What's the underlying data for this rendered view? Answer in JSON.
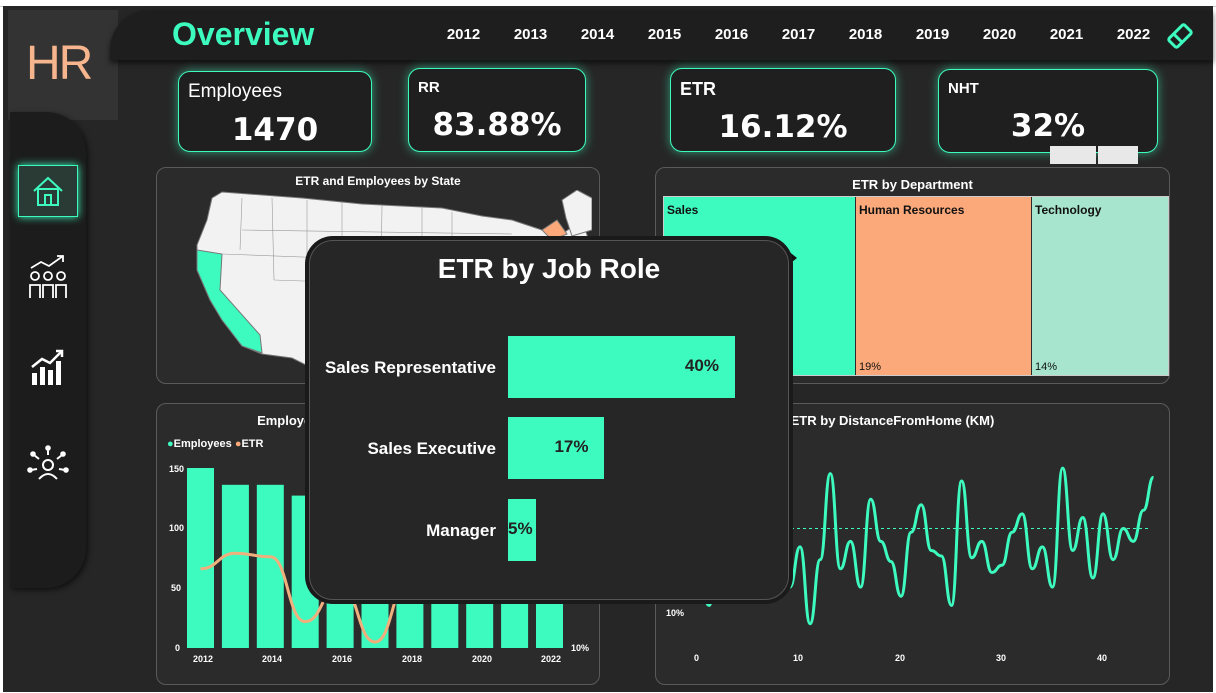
{
  "header": {
    "title": "Overview",
    "years": [
      "2012",
      "2013",
      "2014",
      "2015",
      "2016",
      "2017",
      "2018",
      "2019",
      "2020",
      "2021",
      "2022"
    ]
  },
  "logo": "HR",
  "nav": [
    "home-icon",
    "people-growth-icon",
    "chart-bars-icon",
    "network-person-icon"
  ],
  "kpis": {
    "employees": {
      "label": "Employees",
      "value": "1470"
    },
    "rr": {
      "label": "RR",
      "value": "83.88%"
    },
    "etr": {
      "label": "ETR",
      "value": "16.12%"
    },
    "nht": {
      "label": "NHT",
      "value": "32%"
    }
  },
  "map_panel": {
    "title": "ETR and Employees by State"
  },
  "dept_panel": {
    "title": "ETR by Department",
    "departments": [
      {
        "name": "Sales",
        "value": "",
        "share": 0.46,
        "color": "#3dfbbe"
      },
      {
        "name": "Human Resources",
        "value": "19%",
        "share": 0.3,
        "color": "#fba97a"
      },
      {
        "name": "Technology",
        "value": "14%",
        "share": 0.24,
        "color": "#a7e5cf"
      }
    ]
  },
  "emp_panel": {
    "title": "Employees, ETR",
    "legend": [
      "Employees",
      "ETR"
    ],
    "y_ticks": [
      "150",
      "100",
      "50",
      "0"
    ],
    "x_ticks": [
      "2012",
      "2014",
      "2016",
      "2018",
      "2020",
      "2022"
    ],
    "right_tick": "10%"
  },
  "dist_panel": {
    "title": "ETR by DistanceFromHome (KM)",
    "y_tick": "10%",
    "x_ticks": [
      "0",
      "10",
      "20",
      "30",
      "40"
    ]
  },
  "popup": {
    "title": "ETR by Job Role",
    "roles": [
      {
        "label": "Sales Representative",
        "value": "40%"
      },
      {
        "label": "Sales Executive",
        "value": "17%"
      },
      {
        "label": "Manager",
        "value": "5%"
      }
    ]
  },
  "chart_data": [
    {
      "type": "bar",
      "title": "ETR by Job Role",
      "categories": [
        "Sales Representative",
        "Sales Executive",
        "Manager"
      ],
      "values": [
        40,
        17,
        5
      ],
      "xlim": [
        0,
        52
      ]
    },
    {
      "type": "bar",
      "title": "Employees, ETR",
      "categories": [
        "2012",
        "2013",
        "2014",
        "2015",
        "2016",
        "2017",
        "2018",
        "2019",
        "2020",
        "2021",
        "2022"
      ],
      "series": [
        {
          "name": "Employees",
          "values": [
            150,
            136,
            136,
            127,
            120,
            115,
            110,
            100,
            100,
            100,
            100
          ]
        },
        {
          "name": "ETR",
          "values": [
            66,
            79,
            76,
            22,
            53,
            5,
            58,
            null,
            null,
            null,
            null
          ]
        }
      ],
      "ylim": [
        0,
        160
      ]
    },
    {
      "type": "line",
      "title": "ETR by DistanceFromHome (KM)",
      "x": [
        0,
        1,
        2,
        3,
        4,
        5,
        6,
        7,
        8,
        9,
        10,
        11,
        12,
        13,
        14,
        15,
        16,
        17,
        18,
        19,
        20,
        21,
        22,
        23,
        24,
        25,
        26,
        27,
        28,
        29,
        30,
        31,
        32,
        33,
        34,
        35,
        36,
        37,
        38,
        39,
        40,
        41,
        42,
        43,
        44,
        45
      ],
      "values": [
        35,
        20,
        55,
        40,
        70,
        35,
        75,
        38,
        44,
        30,
        52,
        10,
        45,
        92,
        40,
        55,
        30,
        78,
        55,
        44,
        25,
        60,
        75,
        50,
        47,
        20,
        88,
        46,
        55,
        38,
        42,
        60,
        70,
        40,
        52,
        30,
        95,
        50,
        68,
        35,
        70,
        45,
        62,
        55,
        72,
        90
      ],
      "avg": 62
    }
  ]
}
